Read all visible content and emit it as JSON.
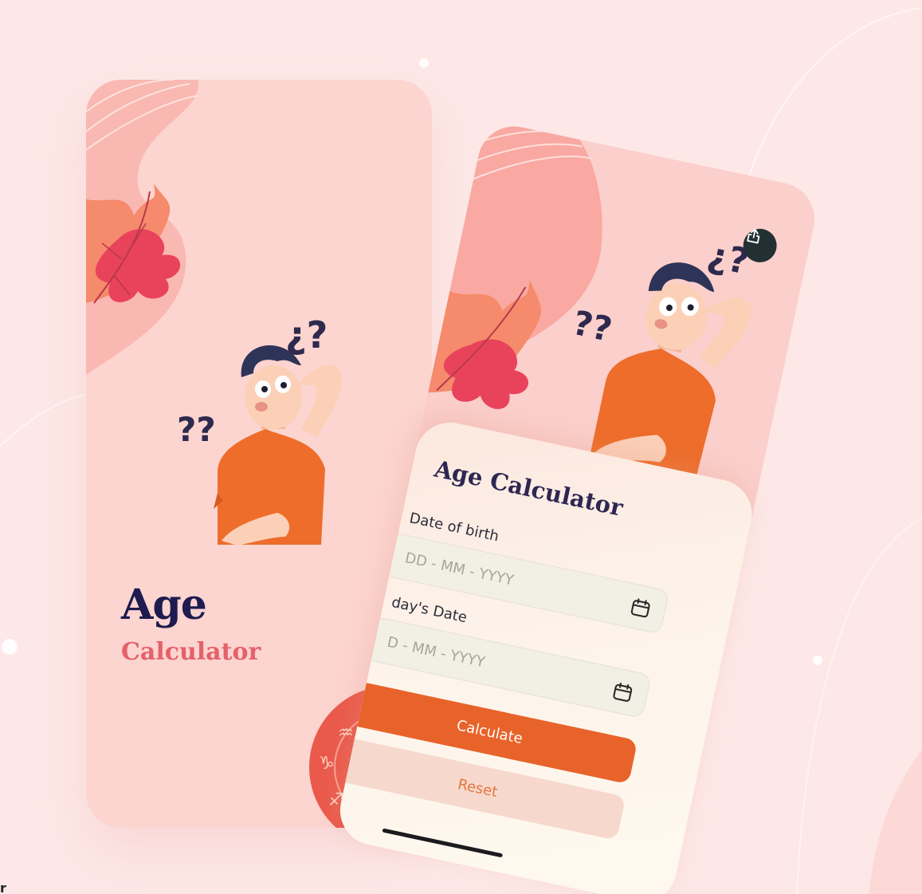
{
  "splash": {
    "title": "Age",
    "subtitle": "Calculator"
  },
  "app": {
    "title": "Age Calculator",
    "share_icon": "share-icon",
    "dob": {
      "label": "Date of birth",
      "placeholder": "DD - MM - YYYY",
      "icon": "calendar-icon"
    },
    "today": {
      "label": "day's Date",
      "placeholder": "D - MM - YYYY",
      "icon": "calendar-icon"
    },
    "calculate_label": "Calculate",
    "reset_label": "Reset"
  },
  "colors": {
    "background": "#fde8e7",
    "navy": "#1d1b4f",
    "coral": "#e5616a",
    "orange": "#e8632a",
    "reset_bg": "#f7d8cc",
    "share_bg": "#233033"
  },
  "corner_text": "r"
}
